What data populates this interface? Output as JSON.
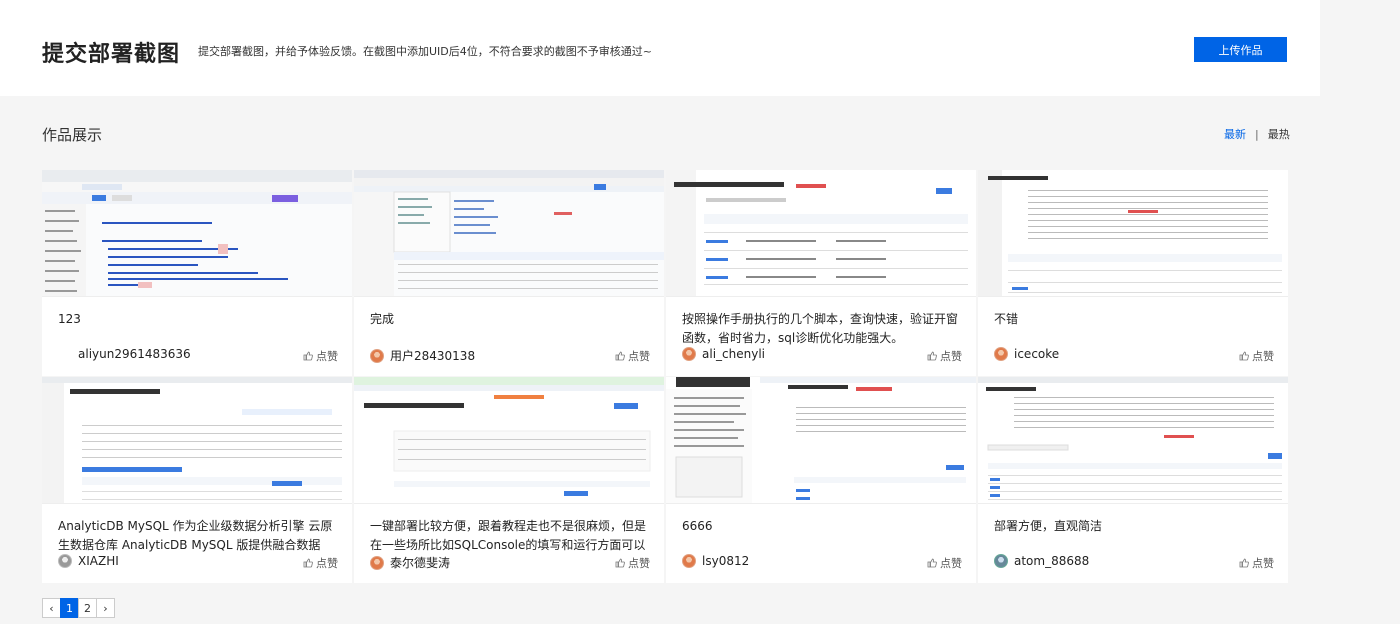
{
  "header": {
    "title": "提交部署截图",
    "description": "提交部署截图，并给予体验反馈。在截图中添加UID后4位，不符合要求的截图不予审核通过~",
    "upload_label": "上传作品"
  },
  "section": {
    "title": "作品展示",
    "sort_latest": "最新",
    "sort_sep": "|",
    "sort_hot": "最热"
  },
  "like_label": "点赞",
  "cards": [
    {
      "text": "123",
      "author": "aliyun2961483636",
      "thumb_label": "UID：8671"
    },
    {
      "text": "完成",
      "author": "用户28430138",
      "thumb_label": ""
    },
    {
      "text": "按照操作手册执行的几个脚本，查询快速，验证开窗函数，省时省力，sql诊断优化功能强大。",
      "author": "ali_chenyli",
      "thumb_label": "amv-uf6v8r9w046s2p43"
    },
    {
      "text": "不错",
      "author": "icecoke",
      "thumb_label": "amv-uf6y2mtq2m40q5"
    },
    {
      "text": "AnalyticDB MySQL 作为企业级数据分析引擎 云原生数据仓库 AnalyticDB MySQL 版提供融合数据库、大数据技术...",
      "author": "XIAZHI",
      "thumb_label": "amv-uf666oco7402u642"
    },
    {
      "text": "一键部署比较方便，跟着教程走也不是很麻烦，但是在一些场所比如SQLConsole的填写和运行方面可以有细致...",
      "author": "泰尔德斐涛",
      "thumb_label": "amv-uf6tp3n65d979s1d"
    },
    {
      "text": "6666",
      "author": "lsy0812",
      "thumb_label": "amv-uf6fvfm6y3ff2e81"
    },
    {
      "text": "部署方便，直观简洁",
      "author": "atom_88688",
      "thumb_label": ""
    }
  ],
  "pagination": {
    "pages": [
      "1",
      "2"
    ],
    "prev": "‹",
    "next": "›"
  }
}
